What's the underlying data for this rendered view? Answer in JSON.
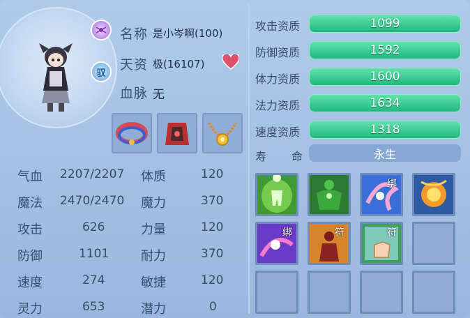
{
  "pet": {
    "name_label": "名称",
    "name_value": "是小岑啊(100)",
    "aptitude_label": "天资",
    "aptitude_value": "极(16107)",
    "bloodline_label": "血脉",
    "bloodline_value": "无",
    "tame_badge": "驭"
  },
  "stats": [
    {
      "label": "气血",
      "value": "2207/2207"
    },
    {
      "label": "魔法",
      "value": "2470/2470"
    },
    {
      "label": "攻击",
      "value": "626"
    },
    {
      "label": "防御",
      "value": "1101"
    },
    {
      "label": "速度",
      "value": "274"
    },
    {
      "label": "灵力",
      "value": "653"
    }
  ],
  "attributes": [
    {
      "label": "体质",
      "value": "120"
    },
    {
      "label": "魔力",
      "value": "370"
    },
    {
      "label": "力量",
      "value": "120"
    },
    {
      "label": "耐力",
      "value": "370"
    },
    {
      "label": "敏捷",
      "value": "120"
    },
    {
      "label": "潜力",
      "value": "0"
    }
  ],
  "qualities": [
    {
      "label": "攻击资质",
      "value": "1099"
    },
    {
      "label": "防御资质",
      "value": "1592"
    },
    {
      "label": "体力资质",
      "value": "1600"
    },
    {
      "label": "法力资质",
      "value": "1634"
    },
    {
      "label": "速度资质",
      "value": "1318"
    }
  ],
  "life": {
    "label_a": "寿",
    "label_b": "命",
    "value": "永生"
  },
  "skills": [
    {
      "icon": "green-aura-skill-icon",
      "tag": ""
    },
    {
      "icon": "green-giant-skill-icon",
      "tag": ""
    },
    {
      "icon": "blue-swirl-skill-icon",
      "tag": "绑"
    },
    {
      "icon": "fire-orb-skill-icon",
      "tag": ""
    },
    {
      "icon": "purple-swirl-skill-icon",
      "tag": "绑"
    },
    {
      "icon": "red-figure-skill-icon",
      "tag": "符"
    },
    {
      "icon": "hand-gesture-skill-icon",
      "tag": "符"
    },
    {
      "icon": "empty-slot",
      "tag": ""
    },
    {
      "icon": "empty-slot",
      "tag": ""
    },
    {
      "icon": "empty-slot",
      "tag": ""
    },
    {
      "icon": "empty-slot",
      "tag": ""
    },
    {
      "icon": "empty-slot",
      "tag": ""
    }
  ]
}
